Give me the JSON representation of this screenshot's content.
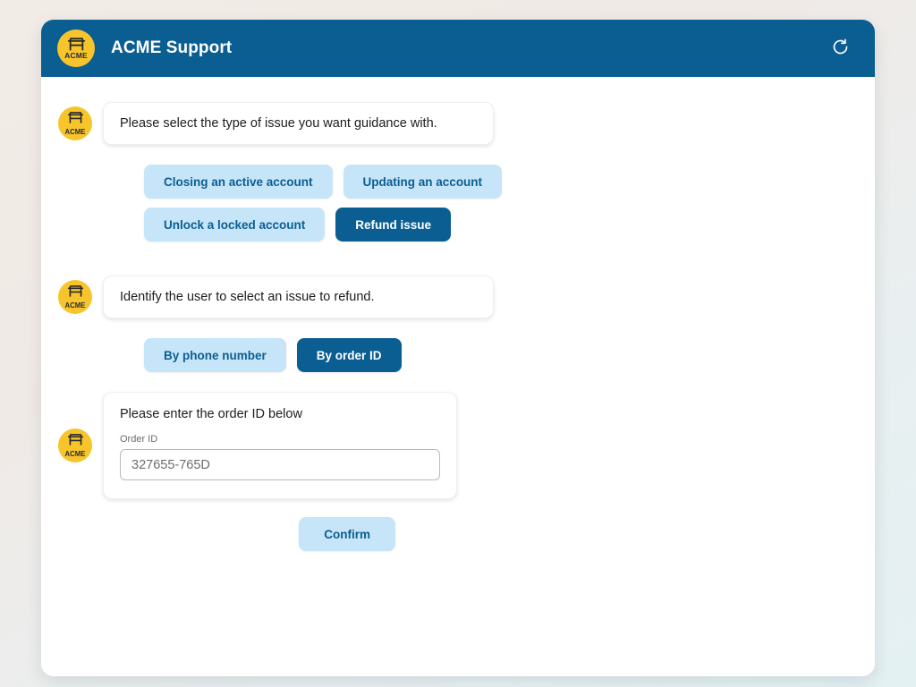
{
  "brand": {
    "name": "ACME",
    "logo_icon": "storefront-icon",
    "logo_bg": "#F7C52B"
  },
  "header": {
    "title": "ACME Support",
    "bg": "#0B5E92",
    "restart_icon": "restart-counterclockwise-icon"
  },
  "theme": {
    "accent_dark": "#0B5E92",
    "accent_light": "#C6E5F8",
    "page_bg_start": "#F2ECE7",
    "page_bg_end": "#E4F1F3"
  },
  "conversation": {
    "message_1": {
      "text": "Please select the type of issue you want guidance with.",
      "options": [
        {
          "label": "Closing an active account",
          "selected": false
        },
        {
          "label": "Updating an account",
          "selected": false
        },
        {
          "label": "Unlock a locked account",
          "selected": false
        },
        {
          "label": "Refund issue",
          "selected": true
        }
      ]
    },
    "message_2": {
      "text": "Identify the user to select an issue to refund.",
      "options": [
        {
          "label": "By phone number",
          "selected": false
        },
        {
          "label": "By order ID",
          "selected": true
        }
      ]
    },
    "message_3": {
      "card_title": "Please enter the order ID below",
      "field_label": "Order ID",
      "field_value": "327655-765D",
      "field_placeholder": "327655-765D",
      "confirm_label": "Confirm"
    }
  }
}
